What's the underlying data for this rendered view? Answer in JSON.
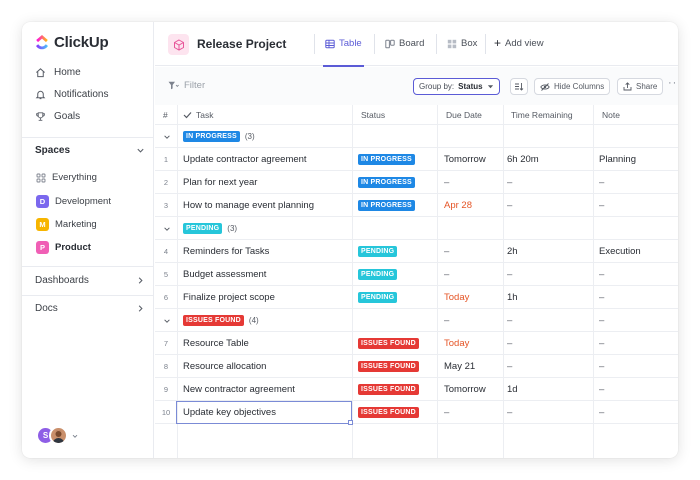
{
  "app": {
    "name": "ClickUp"
  },
  "sidebar": {
    "nav": [
      {
        "label": "Home",
        "icon": "home-icon"
      },
      {
        "label": "Notifications",
        "icon": "bell-icon"
      },
      {
        "label": "Goals",
        "icon": "trophy-icon"
      }
    ],
    "spaces_title": "Spaces",
    "everything_label": "Everything",
    "spaces": [
      {
        "letter": "D",
        "label": "Development",
        "color": "#7b68ee"
      },
      {
        "letter": "M",
        "label": "Marketing",
        "color": "#f7b500"
      },
      {
        "letter": "P",
        "label": "Product",
        "color": "#f05fb5"
      }
    ],
    "dashboards_label": "Dashboards",
    "docs_label": "Docs",
    "avatar_letter": "S"
  },
  "header": {
    "project_title": "Release Project",
    "views": [
      {
        "label": "Table",
        "icon": "table-icon",
        "active": true
      },
      {
        "label": "Board",
        "icon": "board-icon",
        "active": false
      },
      {
        "label": "Box",
        "icon": "box-icon",
        "active": false
      }
    ],
    "add_view_label": "Add view"
  },
  "toolbar": {
    "filter_label": "Filter",
    "group_by_prefix": "Group by:",
    "group_by_value": "Status",
    "hide_columns_label": "Hide Columns",
    "share_label": "Share"
  },
  "table": {
    "headers": {
      "num": "#",
      "task": "Task",
      "status": "Status",
      "due": "Due Date",
      "remaining": "Time Remaining",
      "note": "Note"
    },
    "groups": [
      {
        "label": "IN PROGRESS",
        "count": "(3)",
        "color": "#1e88e5",
        "extra": [
          "",
          "",
          ""
        ]
      },
      {
        "label": "PENDING",
        "count": "(3)",
        "color": "#26c6da",
        "extra": [
          "",
          "",
          ""
        ]
      },
      {
        "label": "ISSUES FOUND",
        "count": "(4)",
        "color": "#e53935",
        "extra": [
          "–",
          "–",
          "–"
        ]
      }
    ],
    "rows": [
      {
        "num": "1",
        "task": "Update contractor agreement",
        "status": "IN PROGRESS",
        "due": "Tomorrow",
        "remaining": "6h 20m",
        "note": "Planning"
      },
      {
        "num": "2",
        "task": "Plan for next year",
        "status": "IN PROGRESS",
        "due": "–",
        "remaining": "–",
        "note": "–"
      },
      {
        "num": "3",
        "task": "How to manage event planning",
        "status": "IN PROGRESS",
        "due": "Apr 28",
        "remaining": "–",
        "note": "–"
      },
      {
        "num": "4",
        "task": "Reminders for Tasks",
        "status": "PENDING",
        "due": "–",
        "remaining": "2h",
        "note": "Execution"
      },
      {
        "num": "5",
        "task": "Budget assessment",
        "status": "PENDING",
        "due": "–",
        "remaining": "–",
        "note": "–"
      },
      {
        "num": "6",
        "task": "Finalize project scope",
        "status": "PENDING",
        "due": "Today",
        "remaining": "1h",
        "note": "–"
      },
      {
        "num": "7",
        "task": "Resource Table",
        "status": "ISSUES FOUND",
        "due": "Today",
        "remaining": "–",
        "note": "–"
      },
      {
        "num": "8",
        "task": "Resource allocation",
        "status": "ISSUES FOUND",
        "due": "May 21",
        "remaining": "–",
        "note": "–"
      },
      {
        "num": "9",
        "task": "New contractor agreement",
        "status": "ISSUES FOUND",
        "due": "Tomorrow",
        "remaining": "1d",
        "note": "–"
      },
      {
        "num": "10",
        "task": "Update key objectives",
        "status": "ISSUES FOUND",
        "due": "–",
        "remaining": "–",
        "note": "–"
      }
    ]
  },
  "colors": {
    "accent": "#5b5bd6",
    "in_progress": "#1e88e5",
    "pending": "#26c6da",
    "issues_found": "#e53935",
    "overdue": "#e55527"
  }
}
